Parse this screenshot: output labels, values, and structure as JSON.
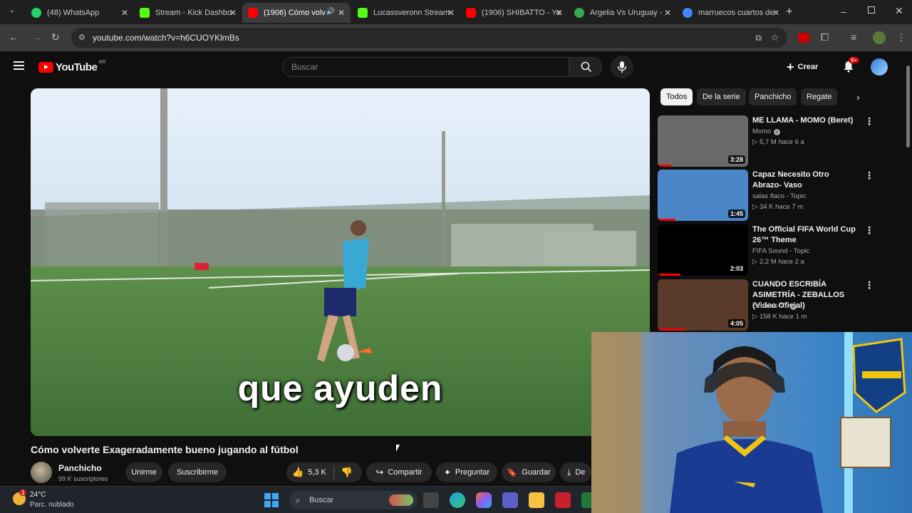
{
  "browser": {
    "tabs": [
      {
        "title": "(48) WhatsApp",
        "icon": "whatsapp-icon",
        "color": "#25d366"
      },
      {
        "title": "Stream - Kick Dashbo",
        "icon": "kick-icon",
        "color": "#53fc18"
      },
      {
        "title": "(1906) Cómo volv",
        "icon": "youtube-icon",
        "color": "#ff0000"
      },
      {
        "title": "Lucassveronn Stream",
        "icon": "kick-icon",
        "color": "#53fc18"
      },
      {
        "title": "(1906) SHIBATTO - Yo",
        "icon": "youtube-icon",
        "color": "#ff0000"
      },
      {
        "title": "Argelia Vs Uruguay -",
        "icon": "globe-icon",
        "color": "#34a853"
      },
      {
        "title": "marruecos cuartos de",
        "icon": "google-icon",
        "color": "#4285f4"
      }
    ],
    "url": "youtube.com/watch?v=h6CUOYKlmBs"
  },
  "youtube": {
    "logo_text": "YouTube",
    "region": "AR",
    "search_placeholder": "Buscar",
    "create_label": "Crear",
    "notif_badge": "9+",
    "video": {
      "caption": "que ayuden",
      "title": "Cómo volverte Exageradamente bueno jugando al fútbol",
      "channel": "Panchicho",
      "subscribers": "99 K suscriptores",
      "join_label": "Unirme",
      "subscribe_label": "Suscribirme",
      "likes": "5,3 K",
      "share_label": "Compartir",
      "ask_label": "Preguntar",
      "save_label": "Guardar",
      "download_label": "De"
    },
    "chips": [
      "Todos",
      "De la serie",
      "Panchicho",
      "Regate"
    ],
    "recommendations": [
      {
        "title": "ME LLAMA - MOMO (Beret)",
        "channel": "Momo",
        "verified": true,
        "stats": "5,7 M  hace 6 a",
        "duration": "3:28",
        "progress": 0.15,
        "thumb_color": "#6a6a6a"
      },
      {
        "title": "Capaz Necesito Otro Abrazo- Vaso",
        "channel": "salas flaco - Topic",
        "verified": false,
        "stats": "34 K  hace 7 m",
        "duration": "1:45",
        "progress": 0.2,
        "thumb_color": "#4a86c8"
      },
      {
        "title": "The Official FIFA World Cup 26™ Theme",
        "channel": "FIFA Sound - Topic",
        "verified": false,
        "stats": "2,2 M  hace 2 a",
        "duration": "2:03",
        "progress": 0.25,
        "thumb_color": "#000000"
      },
      {
        "title": "CUANDO ESCRIBÍA ASIMETRÍA - ZEBALLOS (Video Oficial)",
        "channel": "Zeballos 17",
        "verified": true,
        "stats": "158 K  hace 1 m",
        "duration": "4:05",
        "progress": 0.3,
        "thumb_color": "#5a3a2a"
      }
    ]
  },
  "taskbar": {
    "weather_temp": "24°C",
    "weather_desc": "Parc. nublado",
    "weather_badge": "1",
    "search_placeholder": "Buscar"
  }
}
